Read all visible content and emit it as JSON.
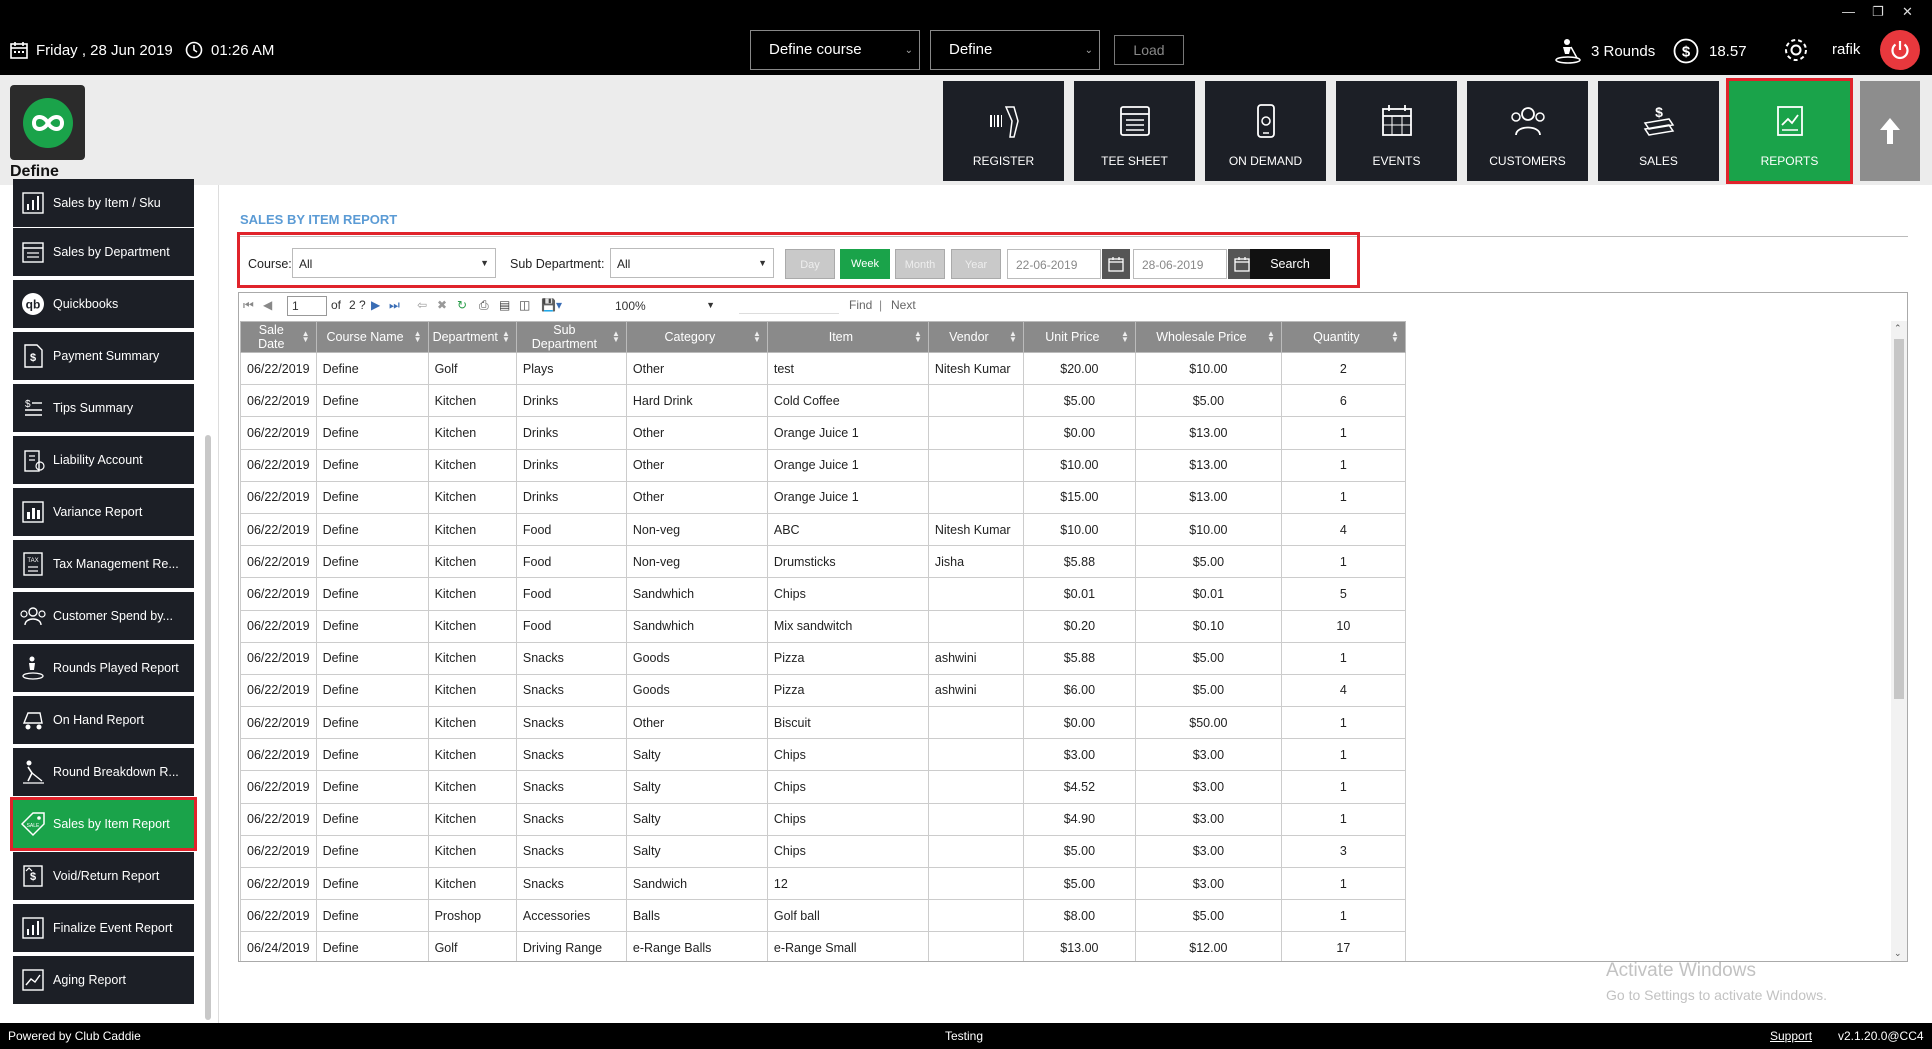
{
  "topbar": {
    "date": "Friday ,  28 Jun 2019",
    "time": "01:26 AM",
    "course_select": "Define course",
    "define_select": "Define",
    "load_label": "Load",
    "rounds": "3 Rounds",
    "balance": "18.57",
    "user": "rafik"
  },
  "brand": {
    "label": "Define"
  },
  "nav": [
    {
      "label": "REGISTER",
      "icon": "barcode-scanner-icon"
    },
    {
      "label": "TEE SHEET",
      "icon": "tee-sheet-icon"
    },
    {
      "label": "ON DEMAND",
      "icon": "phone-icon"
    },
    {
      "label": "EVENTS",
      "icon": "calendar-icon"
    },
    {
      "label": "CUSTOMERS",
      "icon": "users-icon"
    },
    {
      "label": "SALES",
      "icon": "cash-icon"
    },
    {
      "label": "REPORTS",
      "icon": "report-icon",
      "active": true
    }
  ],
  "sidebar": {
    "items": [
      {
        "label": "Sales by Item / Sku"
      },
      {
        "label": "Sales by Department"
      },
      {
        "label": "Quickbooks"
      },
      {
        "label": "Payment Summary"
      },
      {
        "label": "Tips Summary"
      },
      {
        "label": "Liability Account"
      },
      {
        "label": "Variance Report"
      },
      {
        "label": "Tax Management Re..."
      },
      {
        "label": "Customer Spend by..."
      },
      {
        "label": "Rounds Played Report"
      },
      {
        "label": "On Hand Report"
      },
      {
        "label": "Round Breakdown R..."
      },
      {
        "label": "Sales by Item Report",
        "active": true
      },
      {
        "label": "Void/Return Report"
      },
      {
        "label": "Finalize Event Report"
      },
      {
        "label": "Aging Report"
      }
    ]
  },
  "report": {
    "title": "SALES BY ITEM REPORT",
    "filters": {
      "course_label": "Course:",
      "course_value": "All",
      "subdept_label": "Sub Department:",
      "subdept_value": "All",
      "period_buttons": [
        "Day",
        "Week",
        "Month",
        "Year"
      ],
      "active_period": "Week",
      "from_date": "22-06-2019",
      "to_date": "28-06-2019",
      "search_label": "Search"
    },
    "toolbar": {
      "page": "1",
      "of": "of",
      "total_pages": "2 ?",
      "zoom": "100%",
      "find": "Find",
      "next": "Next"
    },
    "columns": [
      "Sale Date",
      "Course Name",
      "Department",
      "Sub Department",
      "Category",
      "Item",
      "Vendor",
      "Unit Price",
      "Wholesale Price",
      "Quantity"
    ],
    "rows": [
      [
        "06/22/2019",
        "Define",
        "Golf",
        "Plays",
        "Other",
        "test",
        "Nitesh Kumar",
        "$20.00",
        "$10.00",
        "2"
      ],
      [
        "06/22/2019",
        "Define",
        "Kitchen",
        "Drinks",
        "Hard Drink",
        "Cold Coffee",
        "",
        "$5.00",
        "$5.00",
        "6"
      ],
      [
        "06/22/2019",
        "Define",
        "Kitchen",
        "Drinks",
        "Other",
        "Orange Juice 1",
        "",
        "$0.00",
        "$13.00",
        "1"
      ],
      [
        "06/22/2019",
        "Define",
        "Kitchen",
        "Drinks",
        "Other",
        "Orange Juice 1",
        "",
        "$10.00",
        "$13.00",
        "1"
      ],
      [
        "06/22/2019",
        "Define",
        "Kitchen",
        "Drinks",
        "Other",
        "Orange Juice 1",
        "",
        "$15.00",
        "$13.00",
        "1"
      ],
      [
        "06/22/2019",
        "Define",
        "Kitchen",
        "Food",
        "Non-veg",
        "ABC",
        "Nitesh Kumar",
        "$10.00",
        "$10.00",
        "4"
      ],
      [
        "06/22/2019",
        "Define",
        "Kitchen",
        "Food",
        "Non-veg",
        "Drumsticks",
        "Jisha",
        "$5.88",
        "$5.00",
        "1"
      ],
      [
        "06/22/2019",
        "Define",
        "Kitchen",
        "Food",
        "Sandwhich",
        "Chips",
        "",
        "$0.01",
        "$0.01",
        "5"
      ],
      [
        "06/22/2019",
        "Define",
        "Kitchen",
        "Food",
        "Sandwhich",
        "Mix sandwitch",
        "",
        "$0.20",
        "$0.10",
        "10"
      ],
      [
        "06/22/2019",
        "Define",
        "Kitchen",
        "Snacks",
        "Goods",
        "Pizza",
        "ashwini",
        "$5.88",
        "$5.00",
        "1"
      ],
      [
        "06/22/2019",
        "Define",
        "Kitchen",
        "Snacks",
        "Goods",
        "Pizza",
        "ashwini",
        "$6.00",
        "$5.00",
        "4"
      ],
      [
        "06/22/2019",
        "Define",
        "Kitchen",
        "Snacks",
        "Other",
        "Biscuit",
        "",
        "$0.00",
        "$50.00",
        "1"
      ],
      [
        "06/22/2019",
        "Define",
        "Kitchen",
        "Snacks",
        "Salty",
        "Chips",
        "",
        "$3.00",
        "$3.00",
        "1"
      ],
      [
        "06/22/2019",
        "Define",
        "Kitchen",
        "Snacks",
        "Salty",
        "Chips",
        "",
        "$4.52",
        "$3.00",
        "1"
      ],
      [
        "06/22/2019",
        "Define",
        "Kitchen",
        "Snacks",
        "Salty",
        "Chips",
        "",
        "$4.90",
        "$3.00",
        "1"
      ],
      [
        "06/22/2019",
        "Define",
        "Kitchen",
        "Snacks",
        "Salty",
        "Chips",
        "",
        "$5.00",
        "$3.00",
        "3"
      ],
      [
        "06/22/2019",
        "Define",
        "Kitchen",
        "Snacks",
        "Sandwich",
        "12",
        "",
        "$5.00",
        "$3.00",
        "1"
      ],
      [
        "06/22/2019",
        "Define",
        "Proshop",
        "Accessories",
        "Balls",
        "Golf ball",
        "",
        "$8.00",
        "$5.00",
        "1"
      ],
      [
        "06/24/2019",
        "Define",
        "Golf",
        "Driving Range",
        "e-Range Balls",
        "e-Range Small",
        "",
        "$13.00",
        "$12.00",
        "17"
      ]
    ]
  },
  "watermark": {
    "line1": "Activate Windows",
    "line2": "Go to Settings to activate Windows."
  },
  "footer": {
    "powered": "Powered by Club Caddie",
    "env": "Testing",
    "support": "Support",
    "version": "v2.1.20.0@CC4"
  },
  "colors": {
    "accent_green": "#1aa34a",
    "highlight_red": "#e0232b",
    "dark_tile": "#1c1f26",
    "title_blue": "#5b9bd5"
  }
}
